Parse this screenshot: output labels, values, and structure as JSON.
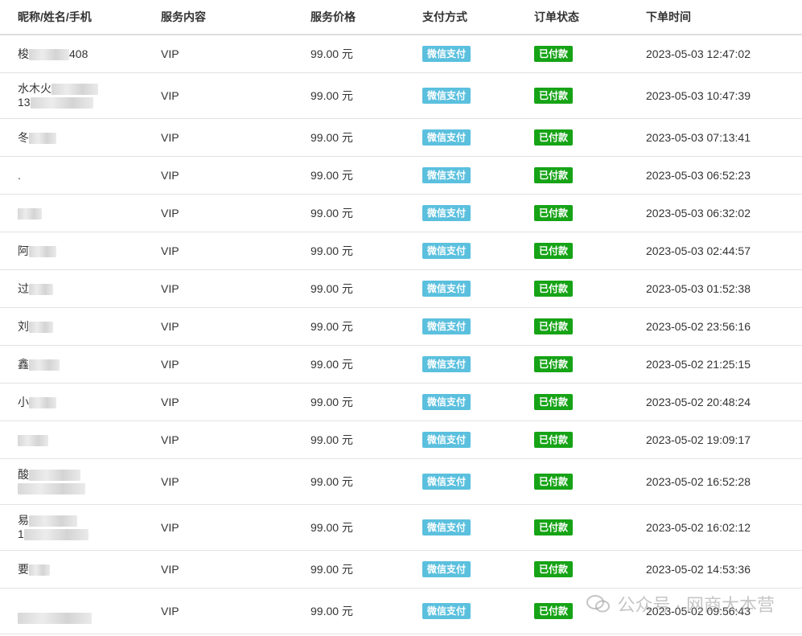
{
  "headers": {
    "nickname": "昵称/姓名/手机",
    "service": "服务内容",
    "price": "服务价格",
    "payment": "支付方式",
    "status": "订单状态",
    "time": "下单时间"
  },
  "colors": {
    "payment_badge": "#5bc0de",
    "status_badge": "#16a316"
  },
  "rows": [
    {
      "name": "梭",
      "phone": "",
      "name_tail": "408",
      "service": "VIP",
      "price": "99.00 元",
      "payment": "微信支付",
      "status": "已付款",
      "time": "2023-05-03 12:47:02"
    },
    {
      "name": "水木火",
      "phone": "13",
      "service": "VIP",
      "price": "99.00 元",
      "payment": "微信支付",
      "status": "已付款",
      "time": "2023-05-03 10:47:39"
    },
    {
      "name": "冬",
      "phone": "",
      "service": "VIP",
      "price": "99.00 元",
      "payment": "微信支付",
      "status": "已付款",
      "time": "2023-05-03 07:13:41"
    },
    {
      "name": ".",
      "phone": "",
      "service": "VIP",
      "price": "99.00 元",
      "payment": "微信支付",
      "status": "已付款",
      "time": "2023-05-03 06:52:23"
    },
    {
      "name": "",
      "phone": "",
      "service": "VIP",
      "price": "99.00 元",
      "payment": "微信支付",
      "status": "已付款",
      "time": "2023-05-03 06:32:02"
    },
    {
      "name": "阿",
      "phone": "",
      "service": "VIP",
      "price": "99.00 元",
      "payment": "微信支付",
      "status": "已付款",
      "time": "2023-05-03 02:44:57"
    },
    {
      "name": "过",
      "phone": "",
      "service": "VIP",
      "price": "99.00 元",
      "payment": "微信支付",
      "status": "已付款",
      "time": "2023-05-03 01:52:38"
    },
    {
      "name": "刘",
      "phone": "",
      "service": "VIP",
      "price": "99.00 元",
      "payment": "微信支付",
      "status": "已付款",
      "time": "2023-05-02 23:56:16"
    },
    {
      "name": "鑫",
      "phone": "",
      "service": "VIP",
      "price": "99.00 元",
      "payment": "微信支付",
      "status": "已付款",
      "time": "2023-05-02 21:25:15"
    },
    {
      "name": "小",
      "phone": "",
      "service": "VIP",
      "price": "99.00 元",
      "payment": "微信支付",
      "status": "已付款",
      "time": "2023-05-02 20:48:24"
    },
    {
      "name": "",
      "phone": "",
      "service": "VIP",
      "price": "99.00 元",
      "payment": "微信支付",
      "status": "已付款",
      "time": "2023-05-02 19:09:17"
    },
    {
      "name": "酸",
      "phone": "",
      "service": "VIP",
      "price": "99.00 元",
      "payment": "微信支付",
      "status": "已付款",
      "time": "2023-05-02 16:52:28"
    },
    {
      "name": "易",
      "phone": "1",
      "service": "VIP",
      "price": "99.00 元",
      "payment": "微信支付",
      "status": "已付款",
      "time": "2023-05-02 16:02:12"
    },
    {
      "name": "要",
      "phone": "",
      "service": "VIP",
      "price": "99.00 元",
      "payment": "微信支付",
      "status": "已付款",
      "time": "2023-05-02 14:53:36"
    },
    {
      "name": "",
      "phone": "",
      "service": "VIP",
      "price": "99.00 元",
      "payment": "微信支付",
      "status": "已付款",
      "time": "2023-05-02 09:56:43"
    }
  ],
  "watermark": {
    "text": "公众号 · 网商大本营"
  }
}
